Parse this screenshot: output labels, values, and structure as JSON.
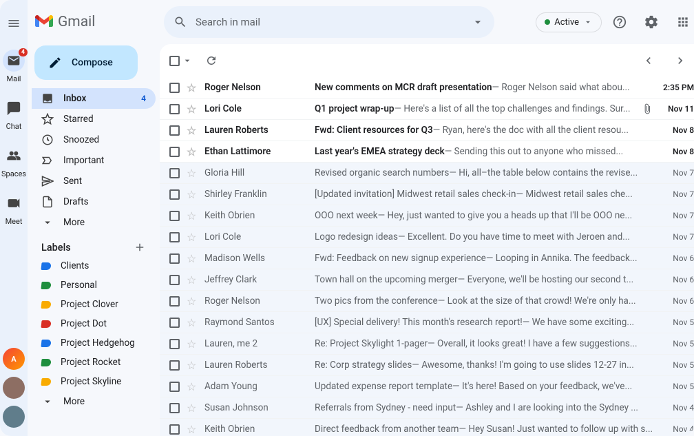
{
  "header": {
    "app_name": "Gmail",
    "search_placeholder": "Search in mail",
    "status_label": "Active"
  },
  "rail": {
    "items": [
      {
        "label": "Mail",
        "badge": "4",
        "active": true
      },
      {
        "label": "Chat"
      },
      {
        "label": "Spaces"
      },
      {
        "label": "Meet"
      }
    ]
  },
  "sidebar": {
    "compose_label": "Compose",
    "folders": [
      {
        "label": "Inbox",
        "count": "4",
        "active": true,
        "icon": "inbox"
      },
      {
        "label": "Starred",
        "icon": "star"
      },
      {
        "label": "Snoozed",
        "icon": "clock"
      },
      {
        "label": "Important",
        "icon": "important"
      },
      {
        "label": "Sent",
        "icon": "send"
      },
      {
        "label": "Drafts",
        "icon": "draft"
      },
      {
        "label": "More",
        "icon": "chevron-down"
      }
    ],
    "labels_header": "Labels",
    "labels": [
      {
        "label": "Clients",
        "color": "#1a73e8"
      },
      {
        "label": "Personal",
        "color": "#1e8e3e"
      },
      {
        "label": "Project Clover",
        "color": "#f9ab00"
      },
      {
        "label": "Project Dot",
        "color": "#d93025"
      },
      {
        "label": "Project Hedgehog",
        "color": "#1a73e8"
      },
      {
        "label": "Project Rocket",
        "color": "#1e8e3e"
      },
      {
        "label": "Project Skyline",
        "color": "#f9ab00"
      }
    ],
    "labels_more": "More"
  },
  "mail": [
    {
      "unread": true,
      "sender": "Roger Nelson",
      "subject": "New comments on MCR draft presentation",
      "preview": "Roger Nelson said what abou...",
      "date": "2:35 PM"
    },
    {
      "unread": true,
      "sender": "Lori Cole",
      "subject": "Q1 project wrap-up",
      "preview": "Here's a list of all the top challenges and findings. Sur...",
      "date": "Nov 11",
      "attachment": true
    },
    {
      "unread": true,
      "sender": "Lauren Roberts",
      "subject": "Fwd: Client resources for Q3",
      "preview": "Ryan, here's the doc with all the client resou...",
      "date": "Nov 8"
    },
    {
      "unread": true,
      "sender": "Ethan Lattimore",
      "subject": "Last year's EMEA strategy deck",
      "preview": "Sending this out to anyone who missed...",
      "date": "Nov 8"
    },
    {
      "unread": false,
      "sender": "Gloria Hill",
      "subject": "Revised organic search numbers",
      "preview": "Hi, all–the table below contains the revise...",
      "date": "Nov 7"
    },
    {
      "unread": false,
      "sender": "Shirley Franklin",
      "subject": "[Updated invitation] Midwest retail sales check-in",
      "preview": "Midwest retail sales che...",
      "date": "Nov 7"
    },
    {
      "unread": false,
      "sender": "Keith Obrien",
      "subject": "OOO next week",
      "preview": "Hey, just wanted to give you a heads up that I'll be OOO ne...",
      "date": "Nov 7"
    },
    {
      "unread": false,
      "sender": "Lori Cole",
      "subject": "Logo redesign ideas",
      "preview": "Excellent. Do you have time to meet with Jeroen and...",
      "date": "Nov 7"
    },
    {
      "unread": false,
      "sender": "Madison Wells",
      "subject": "Fwd: Feedback on new signup experience",
      "preview": "Looping in Annika. The feedback...",
      "date": "Nov 6"
    },
    {
      "unread": false,
      "sender": "Jeffrey Clark",
      "subject": "Town hall on the upcoming merger",
      "preview": "Everyone, we'll be hosting our second t...",
      "date": "Nov 6"
    },
    {
      "unread": false,
      "sender": "Roger Nelson",
      "subject": "Two pics from the conference",
      "preview": "Look at the size of that crowd! We're only ha...",
      "date": "Nov 6"
    },
    {
      "unread": false,
      "sender": "Raymond Santos",
      "subject": "[UX] Special delivery! This month's research report!",
      "preview": "We have some exciting...",
      "date": "Nov 5"
    },
    {
      "unread": false,
      "sender": "Lauren, me 2",
      "subject": "Re: Project Skylight 1-pager",
      "preview": "Overall, it looks great! I have a few suggestions...",
      "date": "Nov 5"
    },
    {
      "unread": false,
      "sender": "Lauren Roberts",
      "subject": "Re: Corp strategy slides",
      "preview": "Awesome, thanks! I'm going to use slides 12-27 in...",
      "date": "Nov 5"
    },
    {
      "unread": false,
      "sender": "Adam Young",
      "subject": "Updated expense report template",
      "preview": "It's here! Based on your feedback, we've...",
      "date": "Nov 5"
    },
    {
      "unread": false,
      "sender": "Susan Johnson",
      "subject": "Referrals from Sydney - need input",
      "preview": "Ashley and I are looking into the Sydney ...",
      "date": "Nov 4"
    },
    {
      "unread": false,
      "sender": "Keith Obrien",
      "subject": "Direct feedback from another team",
      "preview": "Hey Susan! Just wanted to follow up with s...",
      "date": "Nov 4"
    }
  ]
}
